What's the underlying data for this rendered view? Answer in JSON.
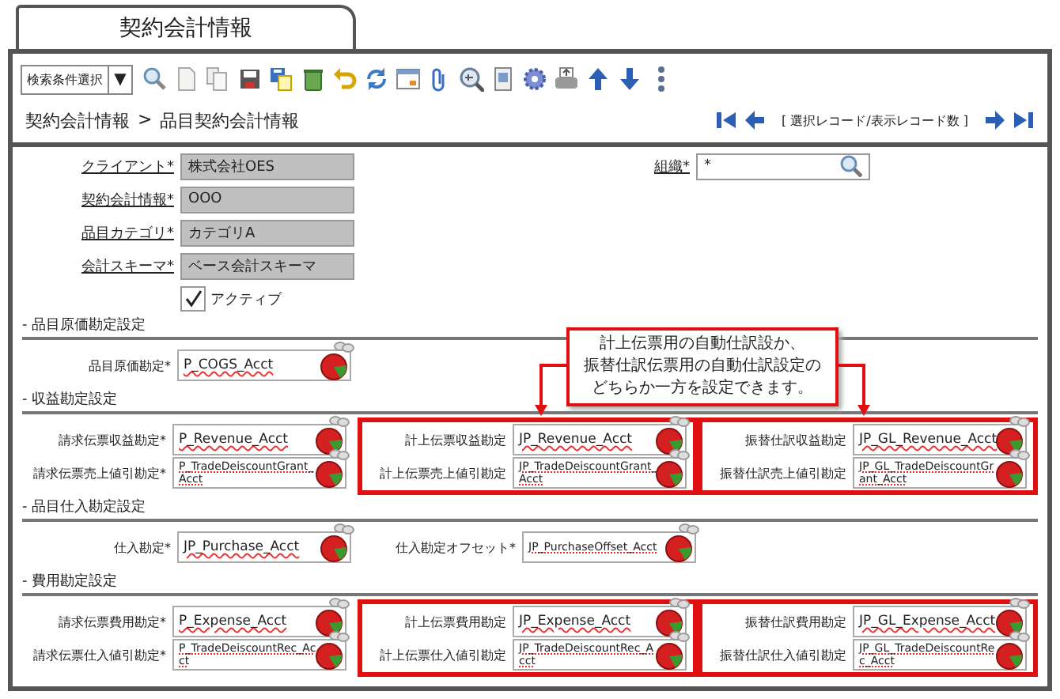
{
  "tab": {
    "title": "契約会計情報"
  },
  "toolbar": {
    "search_select": {
      "value": "検索条件選択",
      "caret": "▼"
    }
  },
  "breadcrumb": {
    "items": [
      "契約会計情報",
      "品目契約会計情報"
    ],
    "separator": ">"
  },
  "record_nav": {
    "label": "[ 選択レコード/表示レコード数 ]"
  },
  "header": {
    "left": [
      {
        "label": "クライアント*",
        "value": "株式会社OES",
        "kind": "readonly"
      },
      {
        "label": "契約会計情報*",
        "value": "OOO",
        "kind": "readonly"
      },
      {
        "label": "品目カテゴリ*",
        "value": "カテゴリA",
        "kind": "readonly"
      },
      {
        "label": "会計スキーマ*",
        "value": "ベース会計スキーマ",
        "kind": "readonly"
      }
    ],
    "right": [
      {
        "label": "組織*",
        "value": "*",
        "kind": "search"
      }
    ],
    "checkbox": {
      "label": "アクティブ",
      "checked": true
    }
  },
  "sections": [
    {
      "title": "- 品目原価勘定設定",
      "columns": [
        {
          "highlighted": false,
          "fields": [
            {
              "label": "品目原価勘定*",
              "value": "P_COGS_Acct"
            }
          ]
        }
      ]
    },
    {
      "title": "- 収益勘定設定",
      "columns": [
        {
          "highlighted": false,
          "fields": [
            {
              "label": "請求伝票収益勘定*",
              "value": "P_Revenue_Acct"
            },
            {
              "label": "請求伝票売上値引勘定*",
              "value": "P_TradeDeiscountGrant_Acct"
            }
          ]
        },
        {
          "highlighted": true,
          "fields": [
            {
              "label": "計上伝票収益勘定",
              "value": "JP_Revenue_Acct"
            },
            {
              "label": "計上伝票売上値引勘定",
              "value": "JP_TradeDeiscountGrant_Acct"
            }
          ]
        },
        {
          "highlighted": true,
          "fields": [
            {
              "label": "振替仕訳収益勘定",
              "value": "JP_GL_Revenue_Acct"
            },
            {
              "label": "振替仕訳売上値引勘定",
              "value": "JP_GL_TradeDeiscountGrant_Acct"
            }
          ]
        }
      ]
    },
    {
      "title": "- 品目仕入勘定設定",
      "columns": [
        {
          "highlighted": false,
          "fields": [
            {
              "label": "仕入勘定*",
              "value": "JP_Purchase_Acct"
            }
          ]
        },
        {
          "highlighted": false,
          "fields": [
            {
              "label": "仕入勘定オフセット*",
              "value": "JP_PurchaseOffset_Acct"
            }
          ]
        }
      ]
    },
    {
      "title": "- 費用勘定設定",
      "columns": [
        {
          "highlighted": false,
          "fields": [
            {
              "label": "請求伝票費用勘定*",
              "value": "P_Expense_Acct"
            },
            {
              "label": "請求伝票仕入値引勘定*",
              "value": "P_TradeDeiscountRec_Acct"
            }
          ]
        },
        {
          "highlighted": true,
          "fields": [
            {
              "label": "計上伝票費用勘定",
              "value": "JP_Expense_Acct"
            },
            {
              "label": "計上伝票仕入値引勘定",
              "value": "JP_TradeDeiscountRec_Acct"
            }
          ]
        },
        {
          "highlighted": true,
          "fields": [
            {
              "label": "振替仕訳費用勘定",
              "value": "JP_GL_Expense_Acct"
            },
            {
              "label": "振替仕訳仕入値引勘定",
              "value": "JP_GL_TradeDeiscountRec_Acct"
            }
          ]
        }
      ]
    }
  ],
  "callout": {
    "lines": [
      "計上伝票用の自動仕訳設か、",
      "振替仕訳伝票用の自動仕訳設定の",
      "どちらか一方を設定できます。"
    ]
  }
}
